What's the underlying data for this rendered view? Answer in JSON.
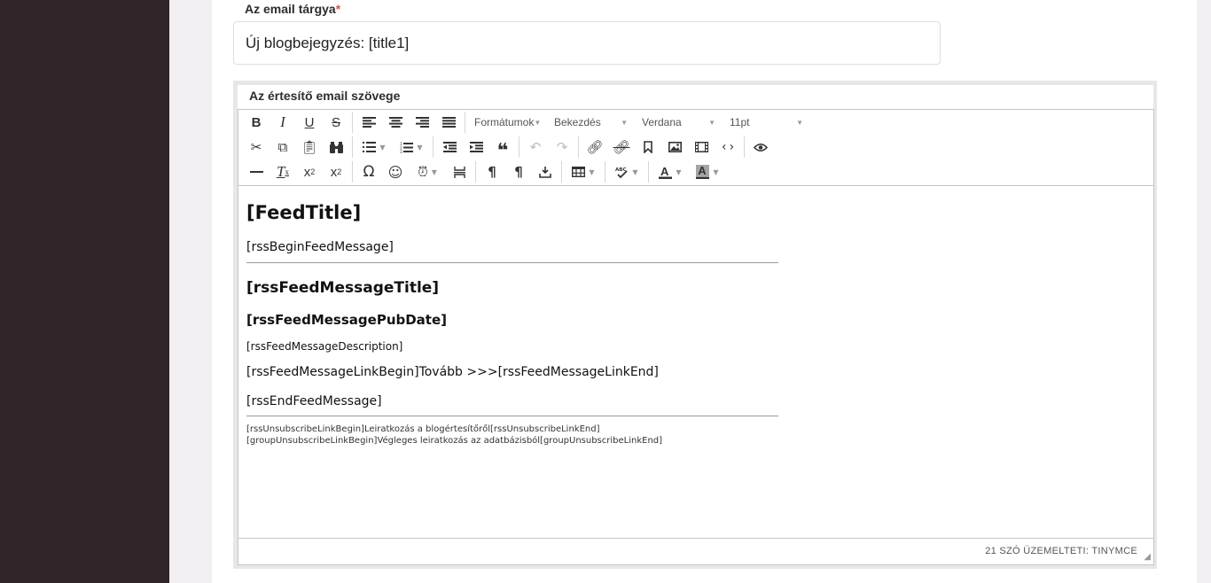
{
  "subject": {
    "label": "Az email tárgya",
    "required_mark": "*",
    "value": "Új blogbejegyzés: [title1]"
  },
  "editor": {
    "label": "Az értesítő email szövege",
    "toolbar": {
      "formats_label": "Formátumok",
      "block_label": "Bekezdés",
      "font_family_label": "Verdana",
      "font_size_label": "11pt"
    },
    "content": {
      "feed_title": "[FeedTitle]",
      "begin_feed_message": "[rssBeginFeedMessage]",
      "message_title": "[rssFeedMessageTitle]",
      "message_pub_date": "[rssFeedMessagePubDate]",
      "message_description": "[rssFeedMessageDescription]",
      "message_link": "[rssFeedMessageLinkBegin]Tovább >>>[rssFeedMessageLinkEnd]",
      "end_feed_message": "[rssEndFeedMessage]",
      "unsubscribe_line": "[rssUnsubscribeLinkBegin]Leiratkozás a blogértesítőről[rssUnsubscribeLinkEnd]",
      "group_unsubscribe_line": "[groupUnsubscribeLinkBegin]Végleges leiratkozás az adatbázisból[groupUnsubscribeLinkEnd]"
    },
    "status": "21 SZÓ ÜZEMELTETI: TINYMCE"
  },
  "icons": [
    "bold-icon",
    "italic-icon",
    "underline-icon",
    "strikethrough-icon",
    "align-left-icon",
    "align-center-icon",
    "align-right-icon",
    "align-justify-icon",
    "cut-icon",
    "copy-icon",
    "paste-icon",
    "find-icon",
    "bullet-list-icon",
    "numbered-list-icon",
    "outdent-icon",
    "indent-icon",
    "blockquote-icon",
    "undo-icon",
    "redo-icon",
    "link-icon",
    "unlink-icon",
    "bookmark-icon",
    "image-icon",
    "media-icon",
    "code-icon",
    "preview-icon",
    "hr-icon",
    "clear-format-icon",
    "subscript-icon",
    "superscript-icon",
    "special-char-icon",
    "emoticon-icon",
    "datetime-icon",
    "page-break-icon",
    "ltr-icon",
    "rtl-icon",
    "template-icon",
    "table-icon",
    "spellcheck-icon",
    "text-color-icon",
    "background-color-icon",
    "resize-handle-icon"
  ],
  "colors": {
    "sidebar": "#2f2428",
    "background": "#f2eef2",
    "required": "#d9534f"
  }
}
